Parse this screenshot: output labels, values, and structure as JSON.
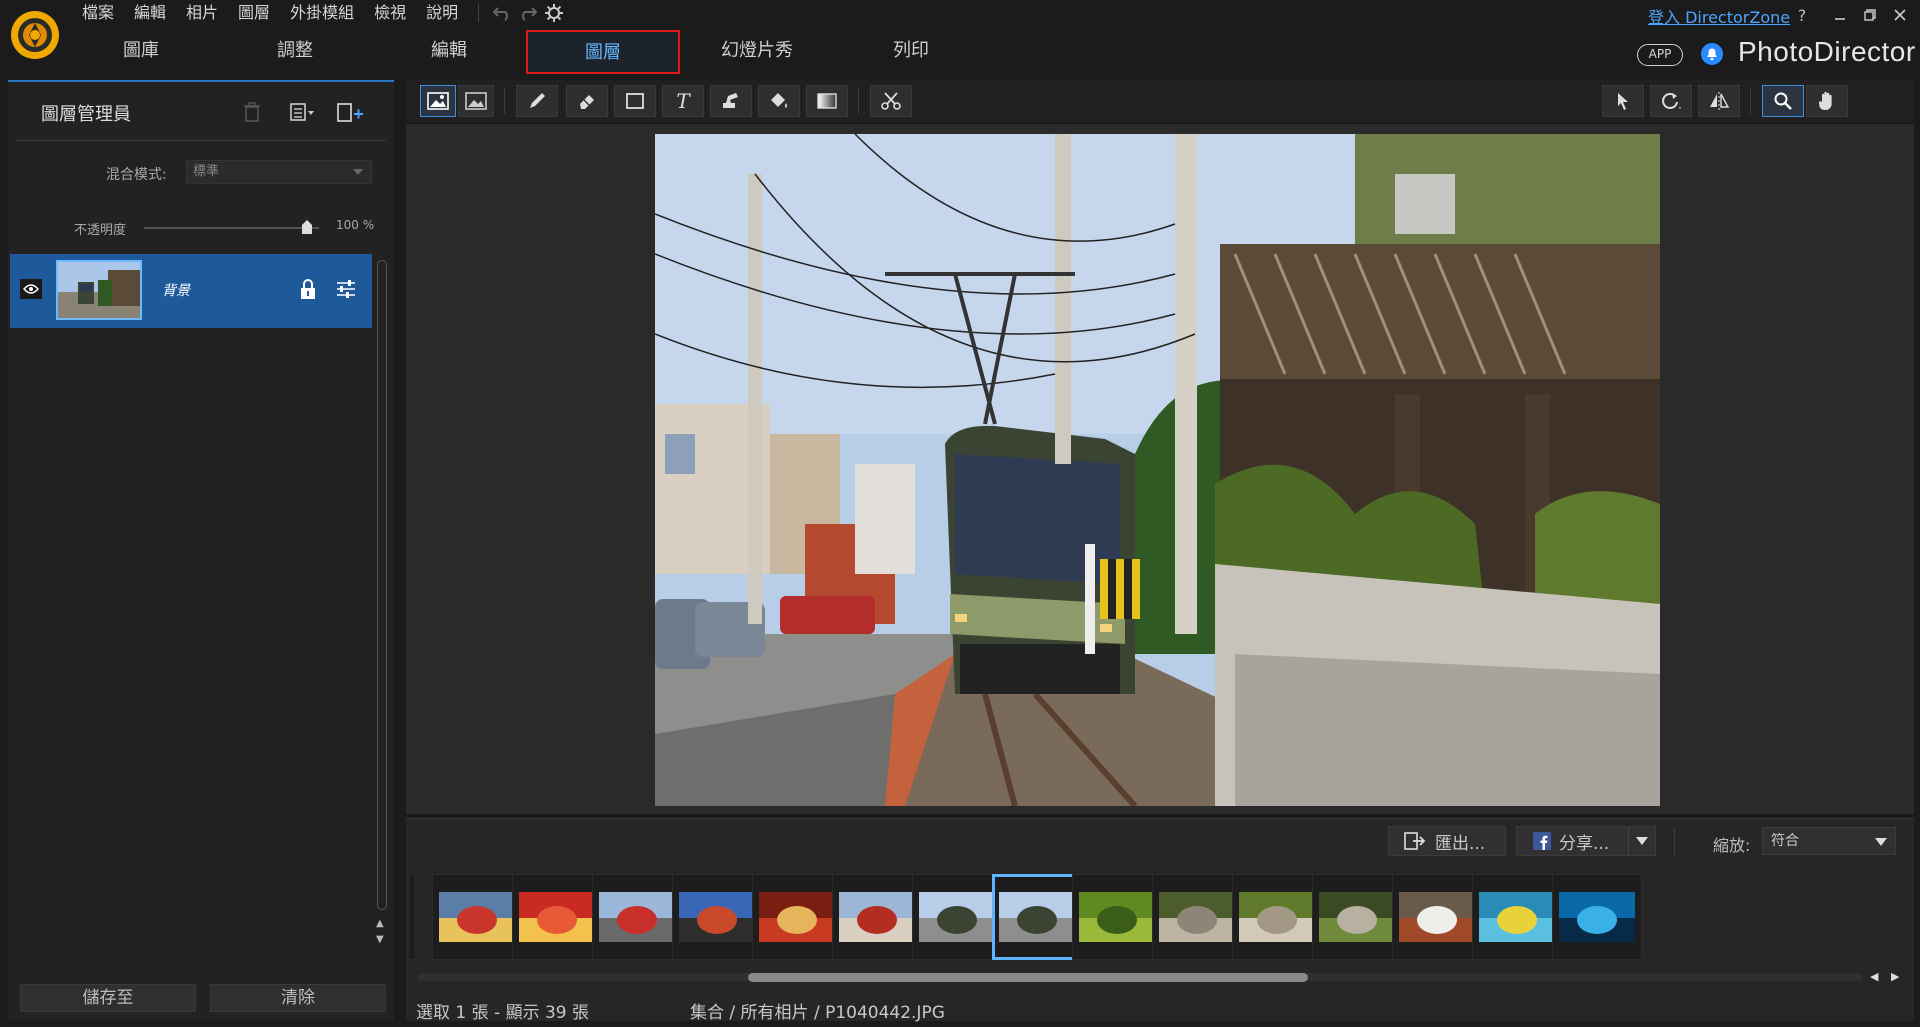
{
  "menu": [
    "檔案",
    "編輯",
    "相片",
    "圖層",
    "外掛模組",
    "檢視",
    "說明"
  ],
  "nav_tabs": [
    {
      "label": "圖庫",
      "active": false
    },
    {
      "label": "調整",
      "active": false
    },
    {
      "label": "編輯",
      "active": false
    },
    {
      "label": "圖層",
      "active": true
    },
    {
      "label": "幻燈片秀",
      "active": false
    },
    {
      "label": "列印",
      "active": false
    }
  ],
  "header": {
    "login_link": "登入 DirectorZone",
    "help": "?",
    "app_badge": "APP",
    "brand": "PhotoDirector"
  },
  "layer_manager": {
    "title": "圖層管理員",
    "blend_mode_label": "混合模式:",
    "blend_mode_value": "標準",
    "opacity_label": "不透明度",
    "opacity_value": "100",
    "opacity_unit": "%",
    "layers": [
      {
        "name": "背景",
        "visible": true,
        "locked": true
      }
    ],
    "save_button": "儲存至",
    "clear_button": "清除"
  },
  "bottom_bar": {
    "export_button": "匯出...",
    "share_button": "分享...",
    "zoom_label": "縮放:",
    "zoom_value": "符合"
  },
  "status": {
    "selection": "選取 1 張 - 顯示 39 張",
    "path": "集合 / 所有相片 / P1040442.JPG"
  },
  "filmstrip": {
    "selected_index": 7,
    "thumbnails": [
      "dragon-float",
      "red-lanterns",
      "temple-street",
      "shopping-street",
      "shrine-plaques",
      "red-temple-gate",
      "tram-street",
      "tram-crossing",
      "green-moss",
      "stone-statues",
      "stone-statue",
      "potted-plants",
      "white-dog",
      "fish-school",
      "aquarium-tunnel"
    ]
  },
  "colors": {
    "accent": "#2a78c4",
    "active_tab_text": "#63b8ff",
    "highlight_border": "#e0191b",
    "selected_layer": "#1e5a9a"
  }
}
